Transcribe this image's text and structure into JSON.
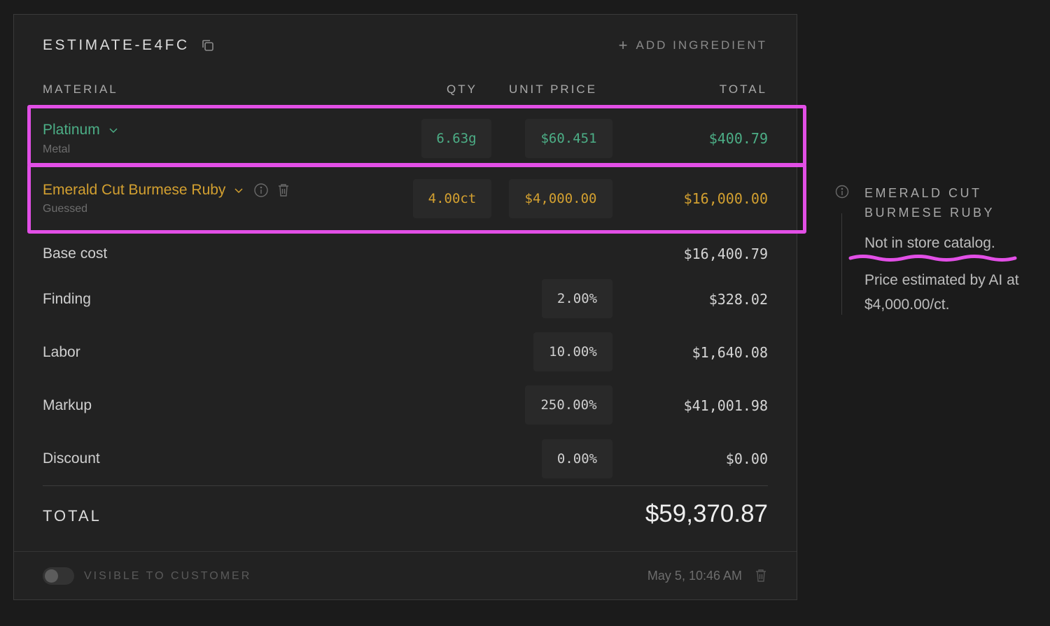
{
  "estimate": {
    "title": "ESTIMATE-E4FC",
    "add_label": "ADD INGREDIENT",
    "columns": {
      "material": "MATERIAL",
      "qty": "QTY",
      "unit_price": "UNIT PRICE",
      "total": "TOTAL"
    },
    "materials": [
      {
        "name": "Platinum",
        "sub": "Metal",
        "qty": "6.63g",
        "unit_price": "$60.451",
        "total": "$400.79",
        "color": "#4cae86"
      },
      {
        "name": "Emerald Cut Burmese Ruby",
        "sub": "Guessed",
        "qty": "4.00ct",
        "unit_price": "$4,000.00",
        "total": "$16,000.00",
        "color": "#d3a030"
      }
    ],
    "base_cost": {
      "label": "Base cost",
      "value": "$16,400.79"
    },
    "adjustments": [
      {
        "label": "Finding",
        "pct": "2.00%",
        "value": "$328.02"
      },
      {
        "label": "Labor",
        "pct": "10.00%",
        "value": "$1,640.08"
      },
      {
        "label": "Markup",
        "pct": "250.00%",
        "value": "$41,001.98"
      },
      {
        "label": "Discount",
        "pct": "0.00%",
        "value": "$0.00"
      }
    ],
    "total": {
      "label": "TOTAL",
      "value": "$59,370.87"
    },
    "footer": {
      "visible_label": "VISIBLE TO CUSTOMER",
      "visible": false,
      "date": "May 5, 10:46 AM"
    }
  },
  "side_panel": {
    "title": "EMERALD CUT BURMESE RUBY",
    "line1": "Not in store catalog.",
    "line2": "Price estimated by AI at $4,000.00/ct."
  },
  "colors": {
    "highlight": "#e24fe6",
    "metal": "#4cae86",
    "guessed": "#d3a030"
  }
}
